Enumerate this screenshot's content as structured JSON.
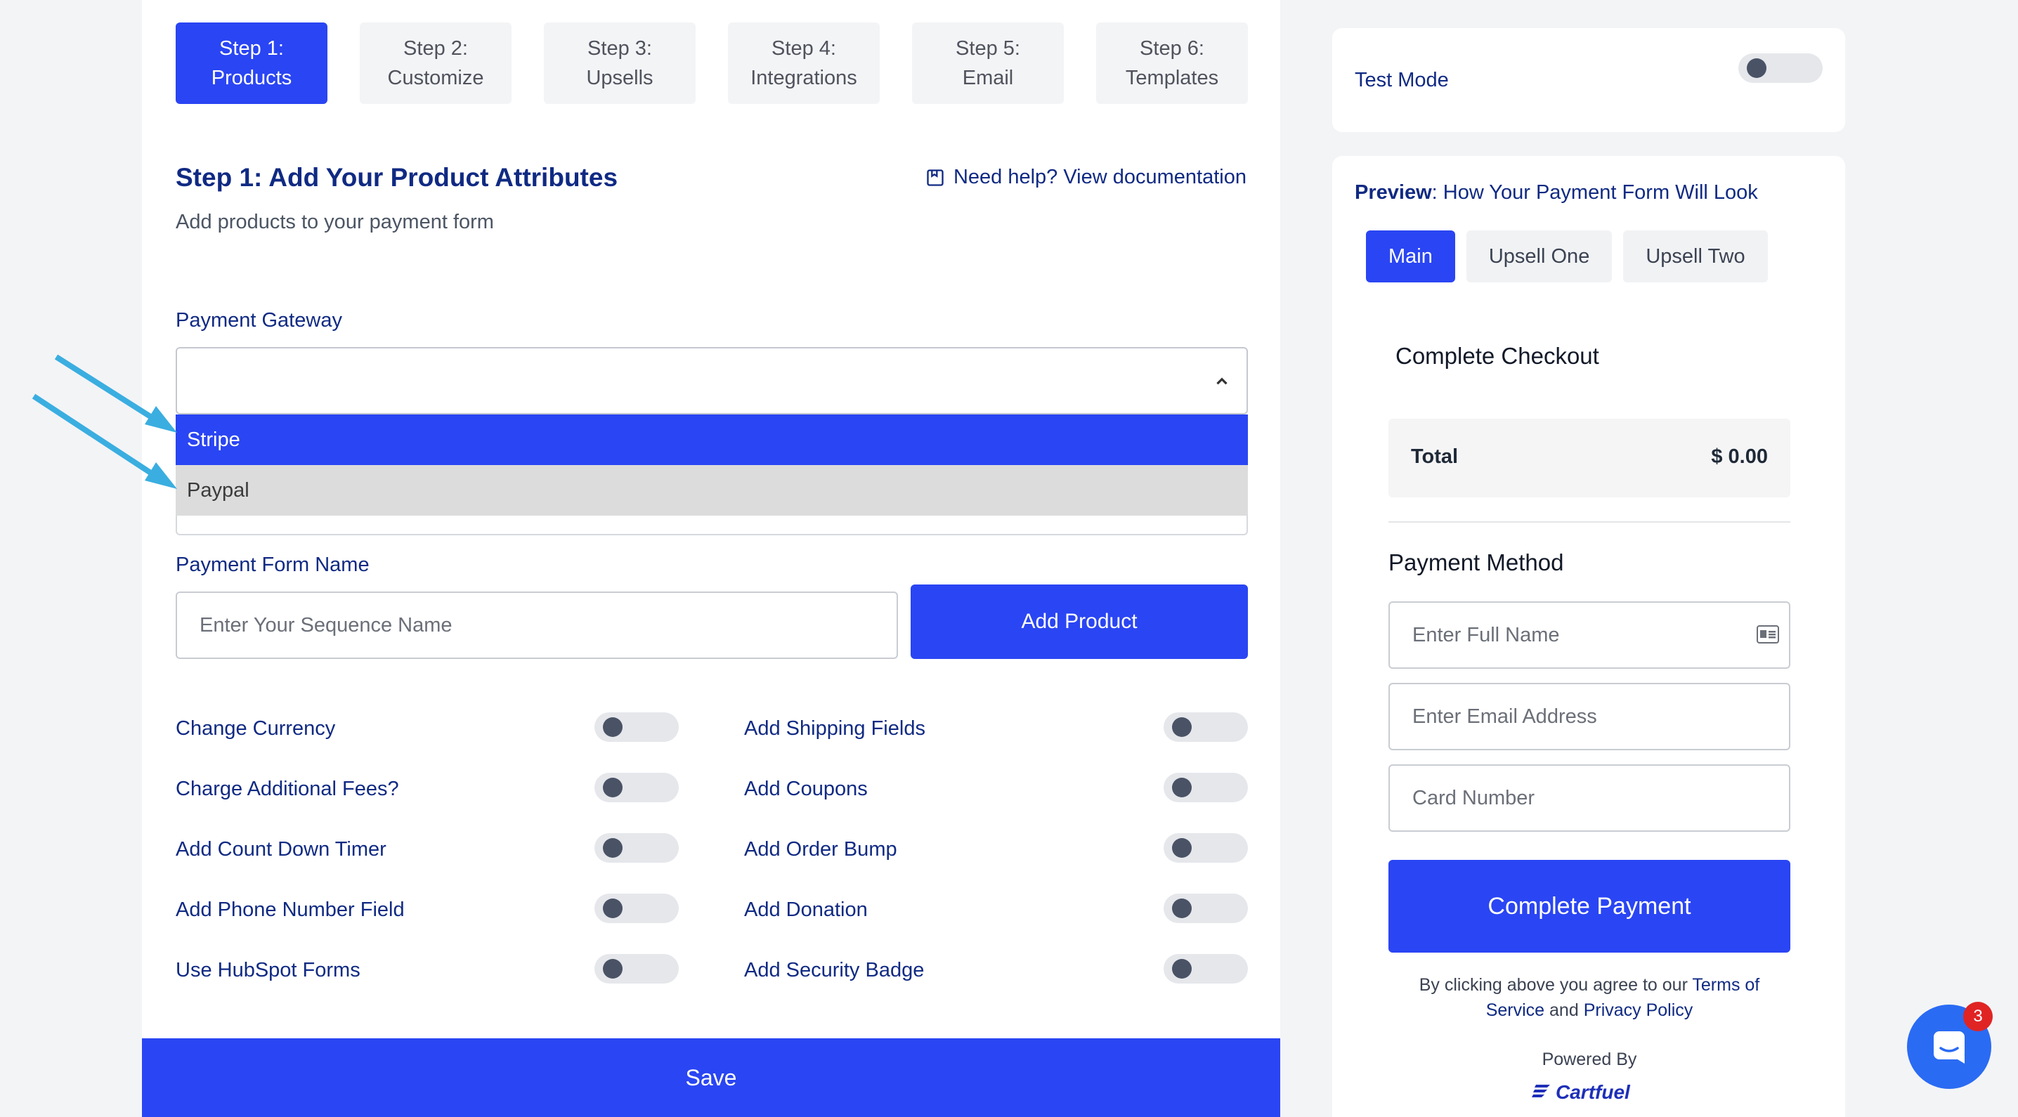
{
  "steps": [
    {
      "line1": "Step 1:",
      "line2": "Products"
    },
    {
      "line1": "Step 2:",
      "line2": "Customize"
    },
    {
      "line1": "Step 3:",
      "line2": "Upsells"
    },
    {
      "line1": "Step 4:",
      "line2": "Integrations"
    },
    {
      "line1": "Step 5:",
      "line2": "Email"
    },
    {
      "line1": "Step 6:",
      "line2": "Templates"
    }
  ],
  "active_step": 1,
  "section": {
    "title": "Step 1: Add Your Product Attributes",
    "subtitle": "Add products to your payment form",
    "help_link": "Need help? View documentation"
  },
  "gateway": {
    "label": "Payment Gateway",
    "value": "",
    "options": [
      "Stripe",
      "Paypal"
    ],
    "highlighted": "Stripe",
    "hovered": "Paypal"
  },
  "form_name": {
    "label": "Payment Form Name",
    "placeholder": "Enter Your Sequence Name",
    "button": "Add Product"
  },
  "options_left": [
    {
      "label": "Change Currency",
      "enabled": false
    },
    {
      "label": "Charge Additional Fees?",
      "enabled": false
    },
    {
      "label": "Add Count Down Timer",
      "enabled": false
    },
    {
      "label": "Add Phone Number Field",
      "enabled": false
    },
    {
      "label": "Use HubSpot Forms",
      "enabled": false
    }
  ],
  "options_right": [
    {
      "label": "Add Shipping Fields",
      "enabled": false
    },
    {
      "label": "Add Coupons",
      "enabled": false
    },
    {
      "label": "Add Order Bump",
      "enabled": false
    },
    {
      "label": "Add Donation",
      "enabled": false
    },
    {
      "label": "Add Security Badge",
      "enabled": false
    }
  ],
  "save_label": "Save",
  "test_mode": {
    "label": "Test Mode",
    "enabled": false
  },
  "preview": {
    "title_bold": "Preview",
    "title_rest": ": How Your Payment Form Will Look",
    "tabs": [
      "Main",
      "Upsell One",
      "Upsell Two"
    ],
    "active_tab": "Main",
    "checkout_title": "Complete Checkout",
    "total_label": "Total",
    "total_value": "$ 0.00",
    "payment_method_title": "Payment Method",
    "full_name_placeholder": "Enter Full Name",
    "email_placeholder": "Enter Email Address",
    "card_placeholder": "Card Number",
    "pay_button": "Complete Payment",
    "terms_prefix": "By clicking above you agree to our ",
    "terms_link": "Terms of Service",
    "terms_and": " and ",
    "privacy_link": "Privacy Policy",
    "powered_by": "Powered By",
    "brand": "Cartfuel"
  },
  "chat": {
    "badge_count": "3"
  },
  "colors": {
    "primary": "#2a45f3",
    "navy": "#102a83",
    "arrow": "#3aaee0",
    "badge": "#e02424"
  }
}
